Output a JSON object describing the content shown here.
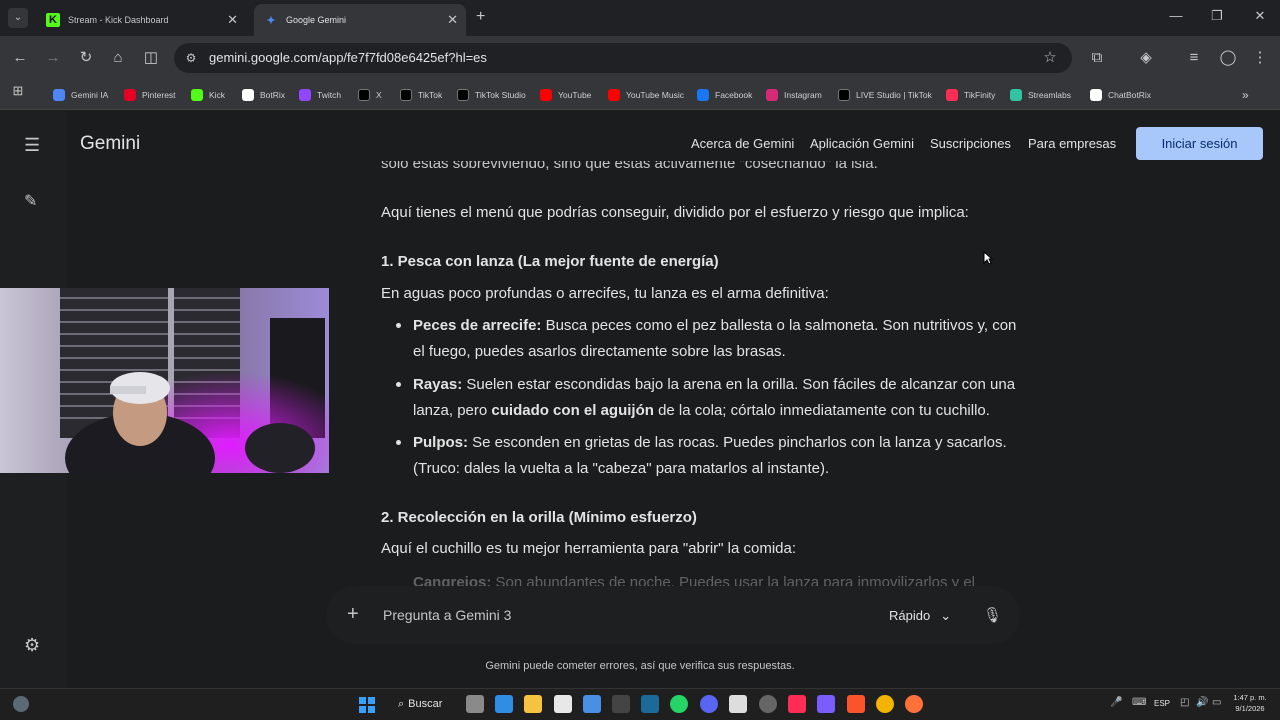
{
  "browser": {
    "tabs": [
      {
        "title": "Stream - Kick Dashboard",
        "favicon_color": "#53fc18"
      },
      {
        "title": "Google Gemini",
        "favicon_color": "#4e86f5"
      }
    ],
    "url": "gemini.google.com/app/fe7f7fd08e6425ef?hl=es",
    "bookmarks": [
      {
        "label": "Gemini IA",
        "color": "#4e86f5"
      },
      {
        "label": "Pinterest",
        "color": "#e60023"
      },
      {
        "label": "Kick",
        "color": "#53fc18"
      },
      {
        "label": "BotRix",
        "color": "#ffffff"
      },
      {
        "label": "Twitch",
        "color": "#9146ff"
      },
      {
        "label": "X",
        "color": "#000000"
      },
      {
        "label": "TikTok",
        "color": "#000000"
      },
      {
        "label": "TikTok Studio",
        "color": "#000000"
      },
      {
        "label": "YouTube",
        "color": "#ff0000"
      },
      {
        "label": "YouTube Music",
        "color": "#ff0000"
      },
      {
        "label": "Facebook",
        "color": "#1877f2"
      },
      {
        "label": "Instagram",
        "color": "#d62976"
      },
      {
        "label": "LIVE Studio | TikTok",
        "color": "#000000"
      },
      {
        "label": "TikFinity",
        "color": "#ff2d55"
      },
      {
        "label": "Streamlabs",
        "color": "#31c3a2"
      },
      {
        "label": "ChatBotRix",
        "color": "#ffffff"
      }
    ]
  },
  "app": {
    "logo": "Gemini",
    "nav": [
      "Acerca de Gemini",
      "Aplicación Gemini",
      "Suscripciones",
      "Para empresas"
    ],
    "signin_label": "Iniciar sesión"
  },
  "content": {
    "partial_top": "solo estás sobreviviendo, sino que estás activamente \"cosechando\" la isla.",
    "intro": "Aquí tienes el menú que podrías conseguir, dividido por el esfuerzo y riesgo que implica:",
    "section1": {
      "heading": "1. Pesca con lanza (La mejor fuente de energía)",
      "lead": "En aguas poco profundas o arrecifes, tu lanza es el arma definitiva:",
      "items": [
        {
          "bold": "Peces de arrecife:",
          "l1": " Busca peces como el pez ballesta o la salmoneta. Son nutritivos y, con",
          "l2": "el fuego, puedes asarlos directamente sobre las brasas."
        },
        {
          "bold": "Rayas:",
          "l1": " Suelen estar escondidas bajo la arena en la orilla. Son fáciles de alcanzar con una",
          "l2a": "lanza, pero ",
          "l2b": "cuidado con el aguijón",
          "l2c": " de la cola; córtalo inmediatamente con tu cuchillo."
        },
        {
          "bold": "Pulpos:",
          "l1": " Se esconden en grietas de las rocas. Puedes pincharlos con la lanza y sacarlos.",
          "l2": "(Truco: dales la vuelta a la \"cabeza\" para matarlos al instante)."
        }
      ]
    },
    "section2": {
      "heading": "2. Recolección en la orilla (Mínimo esfuerzo)",
      "lead": "Aquí el cuchillo es tu mejor herramienta para \"abrir\" la comida:",
      "faded_bold": "Cangrejos:",
      "faded_text": " Son abundantes de noche. Puedes usar la lanza para inmovilizarlos y el"
    }
  },
  "composer": {
    "placeholder": "Pregunta a Gemini 3",
    "mode": "Rápido"
  },
  "disclaimer": "Gemini puede cometer errores, así que verifica sus respuestas.",
  "taskbar": {
    "search_label": "Buscar",
    "lang": "ESP",
    "time": "1:47 p. m.",
    "date": "9/1/2026"
  }
}
